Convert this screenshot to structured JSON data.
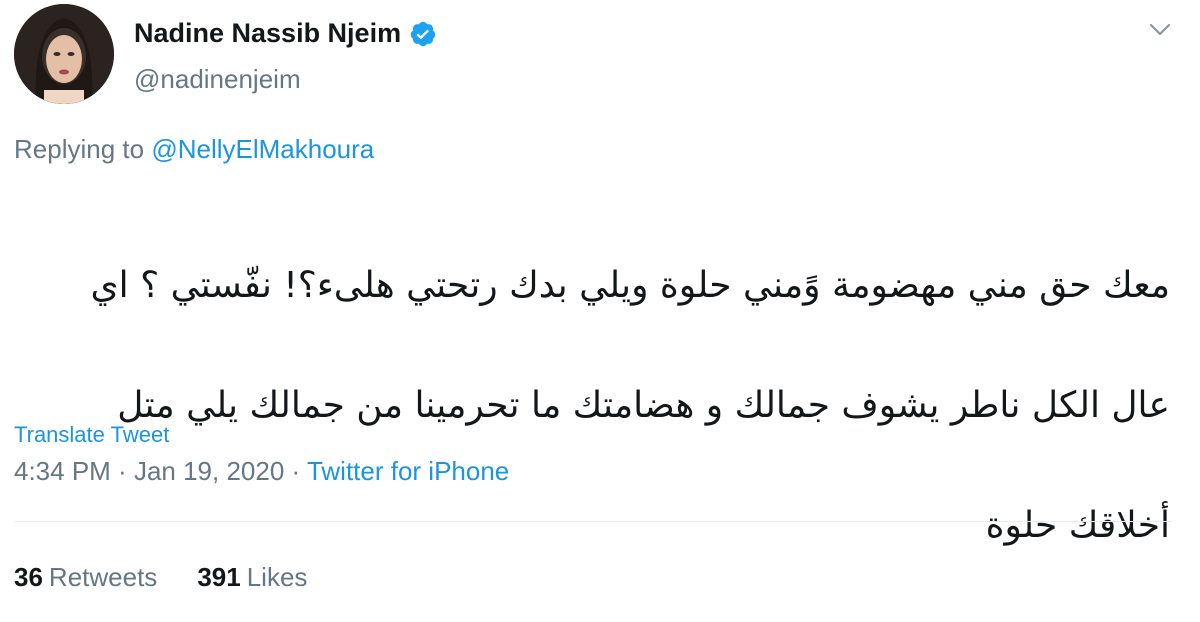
{
  "author": {
    "display_name": "Nadine Nassib Njeim",
    "handle": "@nadinenjeim",
    "verified_icon": "verified-badge-icon",
    "avatar_icon": "avatar"
  },
  "reply": {
    "prefix": "Replying to ",
    "mention": "@NellyElMakhoura"
  },
  "tweet": {
    "text_lines": [
      "معك حق مني مهضومة وًمني حلوة ويلي بدك رتحتي هلىء؟! نفّستي ؟ اي",
      "عال الكل ناطر يشوف جمالك و هضامتك ما تحرمينا من جمالك يلي متل",
      "أخلاقك حلوة"
    ],
    "translate_label": "Translate Tweet",
    "time": "4:34 PM",
    "date": "Jan 19, 2020",
    "separator": " · ",
    "source": "Twitter for iPhone"
  },
  "stats": {
    "retweets_count": "36",
    "retweets_label": "Retweets",
    "likes_count": "391",
    "likes_label": "Likes"
  },
  "colors": {
    "accent": "#1b95e0",
    "secondary_text": "#657786",
    "primary_text": "#14171a",
    "divider": "#e6ecf0"
  },
  "menu_icon": "chevron-down-icon"
}
